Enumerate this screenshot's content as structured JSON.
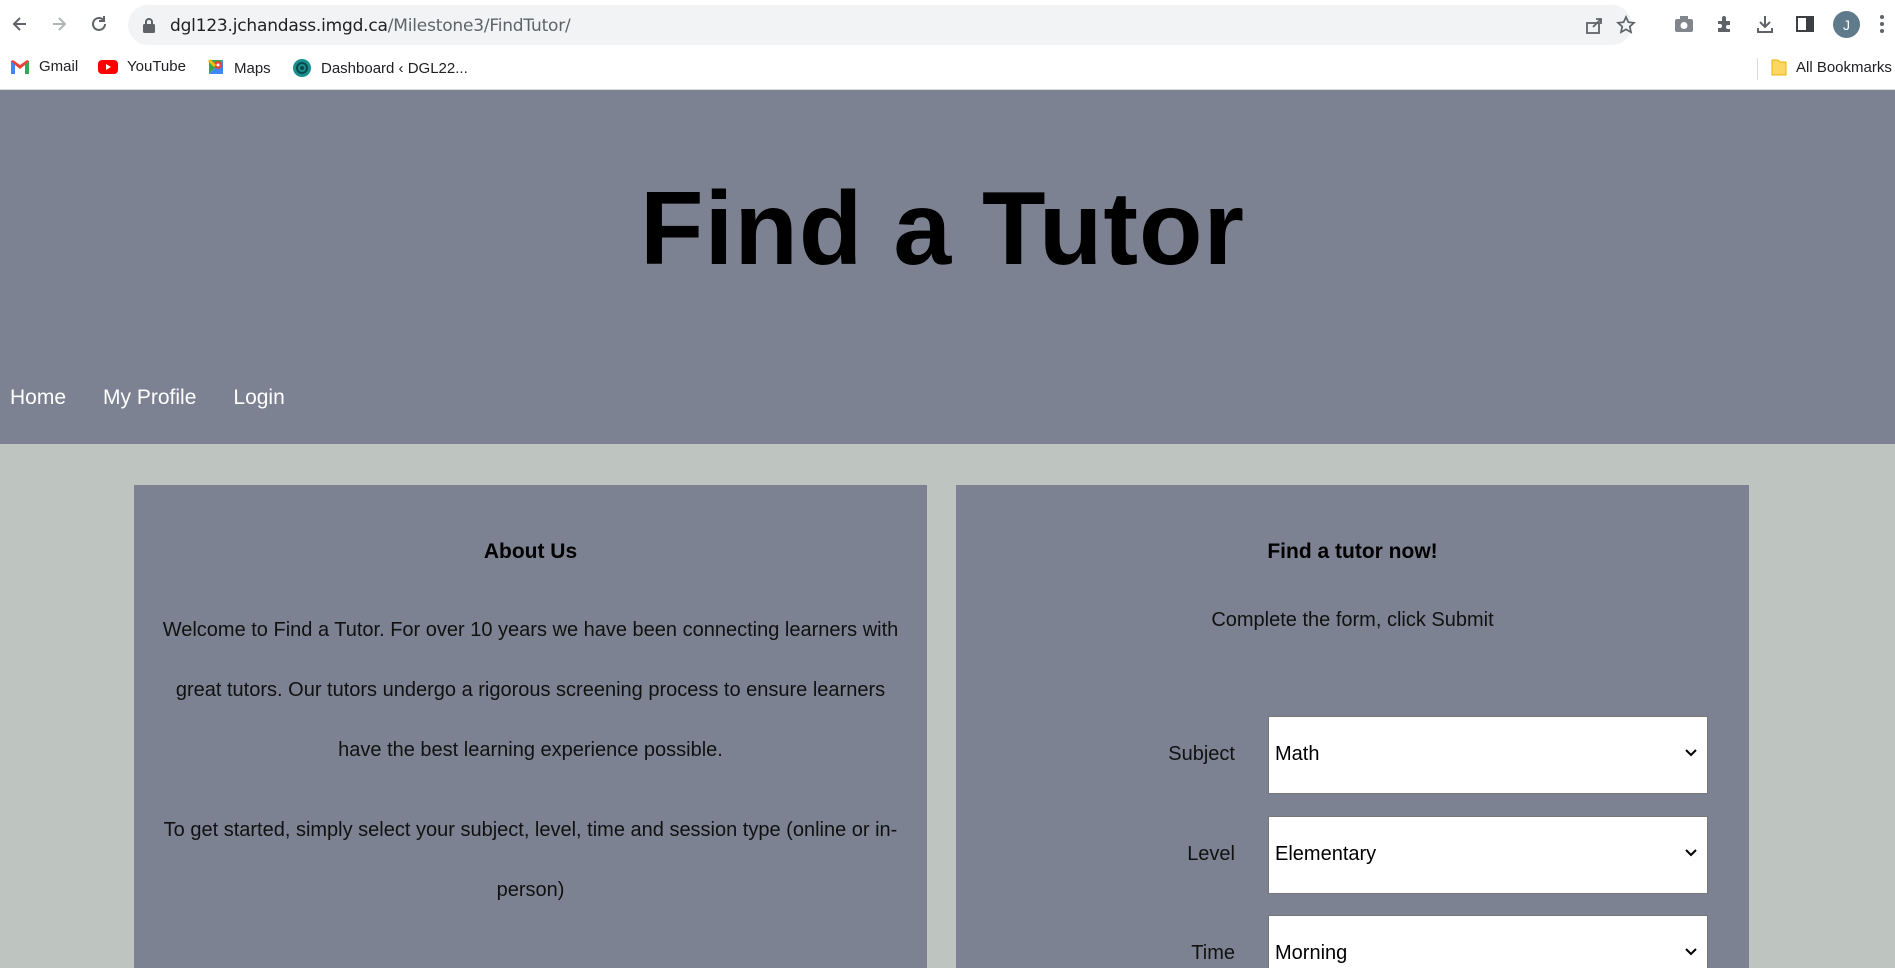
{
  "browser": {
    "url_host": "dgl123.jchandass.imgd.ca",
    "url_path": "/Milestone3/FindTutor/",
    "profile_initial": "J",
    "bookmarks": [
      {
        "label": "Gmail",
        "icon": "gmail-icon"
      },
      {
        "label": "YouTube",
        "icon": "youtube-icon"
      },
      {
        "label": "Maps",
        "icon": "maps-icon"
      },
      {
        "label": "Dashboard ‹ DGL22...",
        "icon": "dashboard-icon"
      }
    ],
    "all_bookmarks_label": "All Bookmarks"
  },
  "site": {
    "title": "Find a Tutor",
    "nav": [
      "Home",
      "My Profile",
      "Login"
    ]
  },
  "about": {
    "heading": "About Us",
    "paragraph1": "Welcome to Find a Tutor. For over 10 years we have been connecting learners with great tutors. Our tutors undergo a rigorous screening process to ensure learners have the best learning experience possible.",
    "paragraph2": "To get started, simply select your subject, level, time and session type (online or in-person)"
  },
  "form": {
    "heading": "Find a tutor now!",
    "intro": "Complete the form, click Submit",
    "fields": [
      {
        "label": "Subject",
        "value": "Math"
      },
      {
        "label": "Level",
        "value": "Elementary"
      },
      {
        "label": "Time",
        "value": "Morning"
      }
    ]
  },
  "colors": {
    "header_bg": "#7c8291",
    "page_bg": "#bec4bf",
    "nav_text": "#ffffff"
  }
}
